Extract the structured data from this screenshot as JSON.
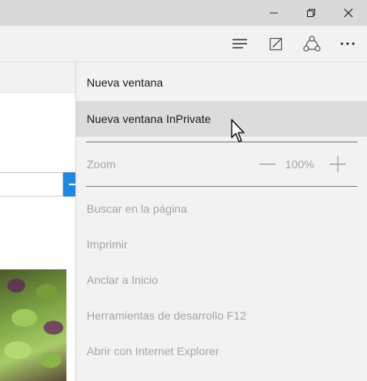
{
  "window": {
    "minimize_icon": "minimize-icon",
    "restore_icon": "restore-icon",
    "close_icon": "close-icon"
  },
  "toolbar": {
    "hub_icon": "hub-icon",
    "note_icon": "web-note-icon",
    "share_icon": "share-icon",
    "more_icon": "more-icon"
  },
  "menu": {
    "new_window": "Nueva ventana",
    "new_inprivate": "Nueva ventana InPrivate",
    "zoom_label": "Zoom",
    "zoom_value": "100%",
    "find": "Buscar en la página",
    "print": "Imprimir",
    "pin": "Anclar a Inicio",
    "devtools": "Herramientas de desarrollo F12",
    "open_ie": "Abrir con Internet Explorer"
  },
  "colors": {
    "titlebar": "#d9d9d9",
    "menu_bg": "#f2f2f2",
    "hover": "#dcdcdc",
    "disabled_text": "#a6a6a6",
    "accent": "#1e88e5"
  }
}
